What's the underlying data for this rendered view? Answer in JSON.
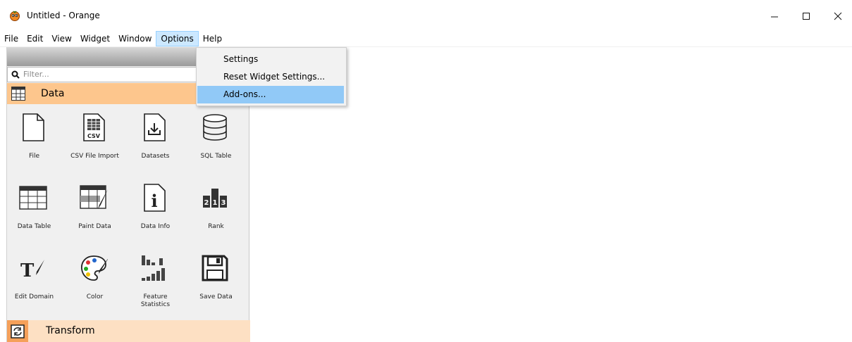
{
  "window": {
    "title": "Untitled  - Orange"
  },
  "menu": [
    "File",
    "Edit",
    "View",
    "Widget",
    "Window",
    "Options",
    "Help"
  ],
  "options_menu": {
    "items": [
      "Settings",
      "Reset Widget Settings...",
      "Add-ons..."
    ]
  },
  "filter": {
    "placeholder": "Filter..."
  },
  "categories": {
    "data": "Data",
    "transform": "Transform"
  },
  "widgets": [
    {
      "label": "File",
      "icon": "file-icon"
    },
    {
      "label": "CSV File Import",
      "icon": "csv-icon"
    },
    {
      "label": "Datasets",
      "icon": "datasets-icon"
    },
    {
      "label": "SQL Table",
      "icon": "database-icon"
    },
    {
      "label": "Data Table",
      "icon": "table-icon"
    },
    {
      "label": "Paint Data",
      "icon": "paint-data-icon"
    },
    {
      "label": "Data Info",
      "icon": "info-icon"
    },
    {
      "label": "Rank",
      "icon": "rank-icon"
    },
    {
      "label": "Edit Domain",
      "icon": "edit-domain-icon"
    },
    {
      "label": "Color",
      "icon": "palette-icon"
    },
    {
      "label": "Feature Statistics",
      "icon": "feature-statistics-icon"
    },
    {
      "label": "Save Data",
      "icon": "floppy-disk-icon"
    }
  ],
  "colors": {
    "data_category": "#fdc68d",
    "transform_category": "#fde0c3",
    "menu_highlight": "#91c9f7",
    "transform_icon": "#f5a05a"
  }
}
